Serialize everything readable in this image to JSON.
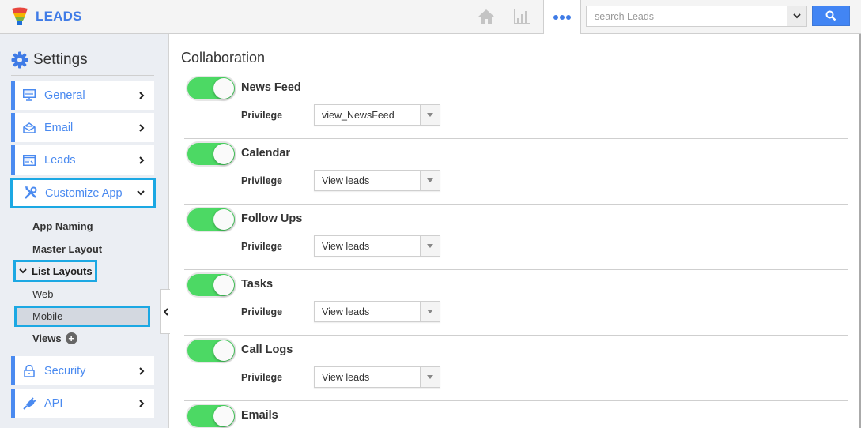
{
  "app": {
    "name": "LEADS"
  },
  "header": {
    "search": {
      "placeholder": "search Leads",
      "value": ""
    },
    "icons": [
      "home-icon",
      "chart-icon",
      "more-icon",
      "search-icon"
    ]
  },
  "sidebar": {
    "title": "Settings",
    "items": [
      {
        "label": "General",
        "icon": "monitor-icon"
      },
      {
        "label": "Email",
        "icon": "envelope-icon"
      },
      {
        "label": "Leads",
        "icon": "window-icon"
      },
      {
        "label": "Customize App",
        "icon": "tools-icon",
        "expanded": true
      },
      {
        "label": "Security",
        "icon": "lock-icon"
      },
      {
        "label": "API",
        "icon": "plug-icon"
      }
    ],
    "subitems": {
      "app_naming": "App Naming",
      "master_layout": "Master Layout",
      "list_layouts": "List Layouts",
      "web": "Web",
      "mobile": "Mobile",
      "views": "Views"
    }
  },
  "content": {
    "title": "Collaboration",
    "privilege_label": "Privilege",
    "modules": [
      {
        "name": "News Feed",
        "enabled": true,
        "privilege": "view_NewsFeed"
      },
      {
        "name": "Calendar",
        "enabled": true,
        "privilege": "View leads"
      },
      {
        "name": "Follow Ups",
        "enabled": true,
        "privilege": "View leads"
      },
      {
        "name": "Tasks",
        "enabled": true,
        "privilege": "View leads"
      },
      {
        "name": "Call Logs",
        "enabled": true,
        "privilege": "View leads"
      },
      {
        "name": "Emails",
        "enabled": true
      }
    ]
  },
  "colors": {
    "accent": "#4a8af0",
    "brand": "#3f7be6",
    "toggle_on": "#4cd964",
    "highlight": "#1ca8e3"
  }
}
